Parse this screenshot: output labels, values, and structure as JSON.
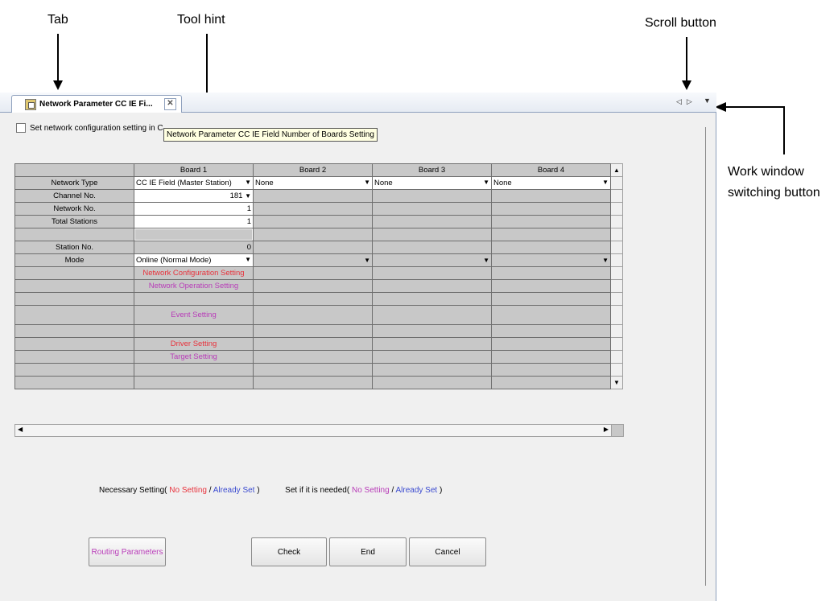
{
  "callouts": {
    "tab": "Tab",
    "tool_hint": "Tool hint",
    "scroll_button": "Scroll button",
    "work_window_line1": "Work window",
    "work_window_line2": "switching button"
  },
  "tab": {
    "title": "Network Parameter CC IE Fi...",
    "close_glyph": "✕",
    "icon": "network-parameter-icon"
  },
  "scroll": {
    "left_glyph": "◁",
    "right_glyph": "▷",
    "switch_glyph": "▼"
  },
  "checkbox": {
    "label": "Set network configuration setting in C",
    "checked": false
  },
  "tooltip": "Network Parameter CC IE Field Number of Boards Setting",
  "grid": {
    "headers": [
      "Board 1",
      "Board 2",
      "Board 3",
      "Board 4"
    ],
    "network_type": {
      "label": "Network Type",
      "board1": "CC IE Field (Master Station)",
      "board2": "None",
      "board3": "None",
      "board4": "None"
    },
    "channel_no": {
      "label": "Channel No.",
      "value": "181"
    },
    "network_no": {
      "label": "Network No.",
      "value": "1"
    },
    "total_stations": {
      "label": "Total Stations",
      "value": "1"
    },
    "station_no": {
      "label": "Station No.",
      "value": "0"
    },
    "mode": {
      "label": "Mode",
      "value": "Online (Normal Mode)"
    },
    "links": {
      "network_configuration": "Network Configuration Setting",
      "network_operation": "Network Operation Setting",
      "event": "Event Setting",
      "driver": "Driver Setting",
      "target": "Target Setting"
    }
  },
  "legend": {
    "necessary": "Necessary Setting(",
    "no_setting": "No Setting",
    "slash": "/",
    "already_set": "Already Set",
    "close": ")",
    "if_needed": "Set if it is needed(",
    "no_setting2": "No Setting",
    "already_set2": "Already Set"
  },
  "buttons": {
    "routing": "Routing Parameters",
    "check": "Check",
    "end": "End",
    "cancel": "Cancel"
  },
  "colors": {
    "necessary": "#e8323c",
    "optional": "#b83cb8",
    "already_set": "#3b4bd0"
  }
}
